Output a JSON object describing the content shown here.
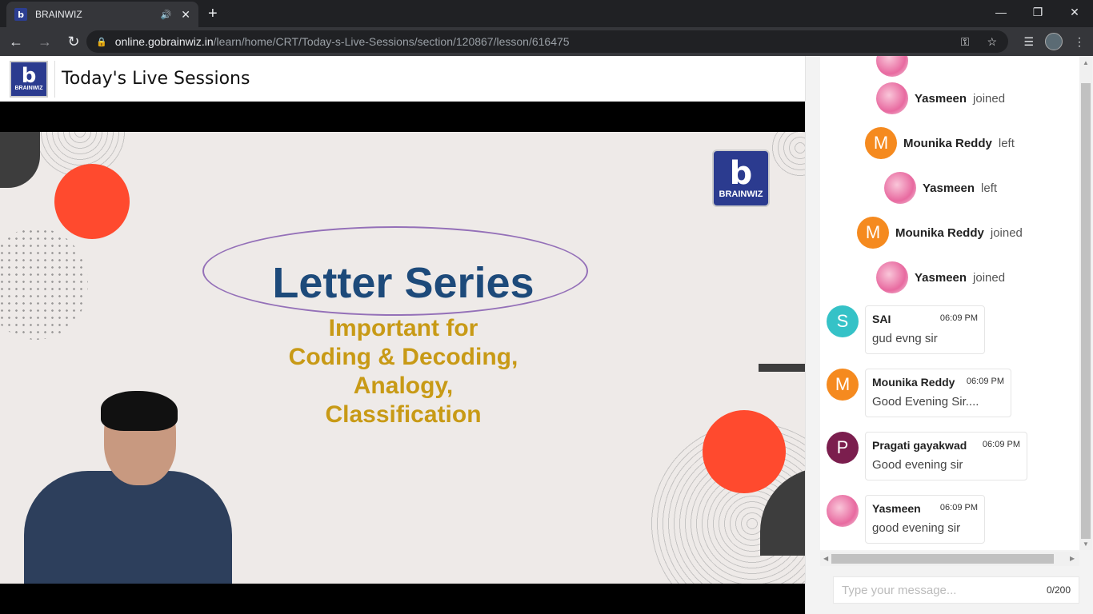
{
  "browser": {
    "tab_title": "BRAINWIZ",
    "favicon_letter": "b",
    "url_host": "online.gobrainwiz.in",
    "url_path": "/learn/home/CRT/Today-s-Live-Sessions/section/120867/lesson/616475"
  },
  "header": {
    "logo_letter": "b",
    "logo_text": "BRAINWIZ",
    "title": "Today's Live Sessions"
  },
  "slide": {
    "logo_letter": "b",
    "logo_text": "BRAINWIZ",
    "heading": "Letter Series",
    "sub1": "Important for",
    "sub2": "Coding & Decoding,",
    "sub3": "Analogy,",
    "sub4": "Classification"
  },
  "chat": {
    "events": [
      {
        "name": "Yasmeen",
        "action": "joined"
      },
      {
        "initial": "M",
        "name": "Mounika Reddy",
        "action": "left"
      },
      {
        "name": "Yasmeen",
        "action": "left"
      },
      {
        "initial": "M",
        "name": "Mounika Reddy",
        "action": "joined"
      },
      {
        "name": "Yasmeen",
        "action": "joined"
      }
    ],
    "messages": [
      {
        "initial": "S",
        "name": "SAI",
        "time": "06:09 PM",
        "text": "gud evng sir"
      },
      {
        "initial": "M",
        "name": "Mounika Reddy",
        "time": "06:09 PM",
        "text": "Good Evening Sir...."
      },
      {
        "initial": "P",
        "name": "Pragati gayakwad",
        "time": "06:09 PM",
        "text": "Good evening sir"
      },
      {
        "name": "Yasmeen",
        "time": "06:09 PM",
        "text": "good evening sir"
      }
    ],
    "input_placeholder": "Type your message...",
    "counter": "0/200"
  },
  "colors": {
    "brand_blue": "#2b3b8f",
    "slide_heading": "#1d4a7a",
    "slide_sub": "#c89a16",
    "accent_red": "#ff4a2e",
    "avatar_orange": "#f58a1f",
    "avatar_teal": "#35c2c7",
    "avatar_maroon": "#7b1e4e"
  }
}
